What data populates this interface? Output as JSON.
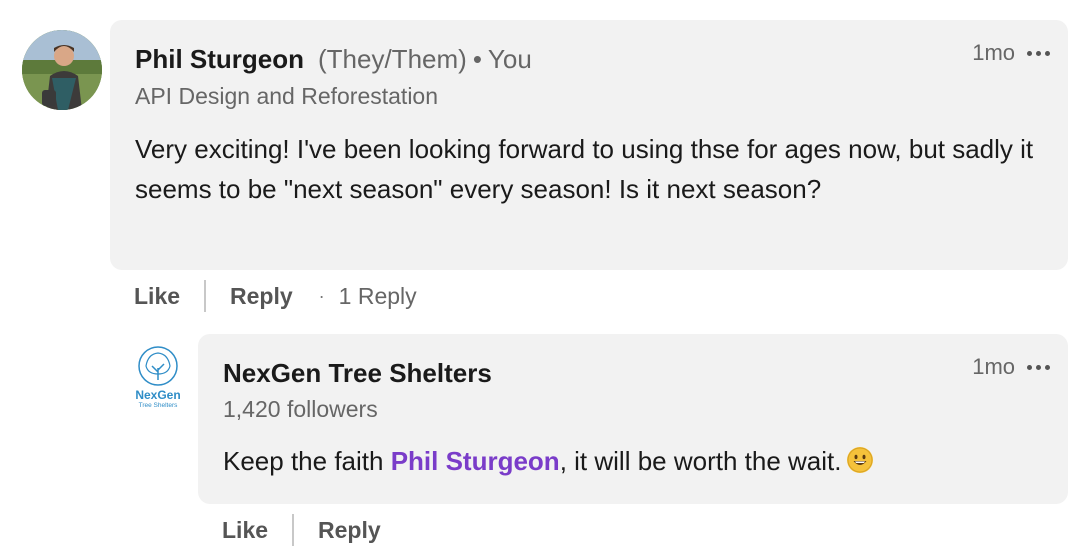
{
  "comment": {
    "author": "Phil Sturgeon",
    "pronouns": "(They/Them)",
    "dot": "•",
    "you_label": "You",
    "headline": "API Design and Reforestation",
    "time": "1mo",
    "text": "Very exciting! I've been looking forward to using thse for ages now, but sadly it seems to be \"next season\" every season! Is it next season?",
    "actions": {
      "like": "Like",
      "reply": "Reply",
      "dot": "·",
      "reply_count": "1 Reply"
    }
  },
  "reply": {
    "author": "NexGen Tree Shelters",
    "followers": "1,420 followers",
    "time": "1mo",
    "text_before": "Keep the faith ",
    "mention": "Phil Sturgeon",
    "text_after": ", it will be worth the wait.",
    "emoji": "grinning-face",
    "logo_name": "NexGen",
    "logo_sub": "Tree Shelters",
    "actions": {
      "like": "Like",
      "reply": "Reply"
    }
  },
  "colors": {
    "bubble": "#f2f2f2",
    "mention": "#7a3cc9",
    "logo": "#2f8dc7"
  }
}
